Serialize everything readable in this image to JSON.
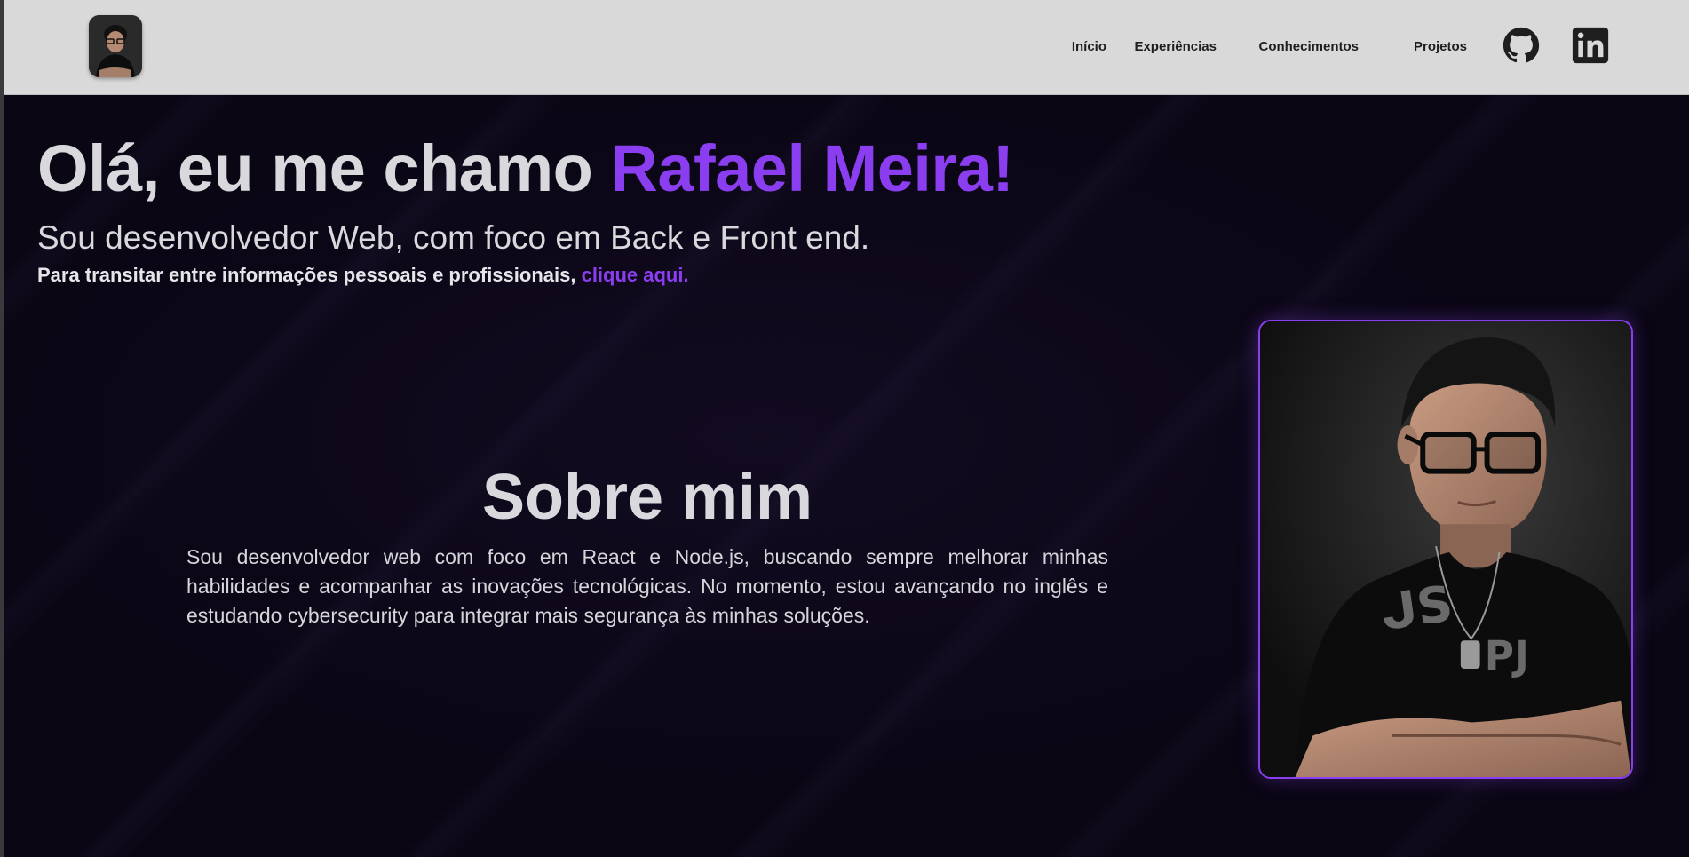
{
  "nav": {
    "items": [
      {
        "label": "Início"
      },
      {
        "label": "Experiências"
      },
      {
        "label": "Conhecimentos"
      },
      {
        "label": "Projetos"
      }
    ],
    "social": [
      {
        "icon": "github-icon"
      },
      {
        "icon": "linkedin-icon"
      }
    ]
  },
  "hero": {
    "greeting": "Olá, eu me chamo ",
    "name": "Rafael Meira!",
    "subtitle": "Sou desenvolvedor Web, com foco em Back e Front end.",
    "note_prefix": "Para transitar entre informações pessoais e profissionais, ",
    "note_link": "clique aqui."
  },
  "about": {
    "title": "Sobre mim",
    "text": "Sou desenvolvedor web com foco em React e Node.js, buscando sempre melhorar minhas habilidades e acompanhar as inovações tecnológicas. No momento, estou avançando no inglês e estudando cybersecurity para integrar mais segurança às minhas soluções."
  },
  "colors": {
    "accent": "#8a3ef0",
    "background": "#0a0614",
    "header": "#d9d9d9",
    "text": "#d9d9dd"
  }
}
